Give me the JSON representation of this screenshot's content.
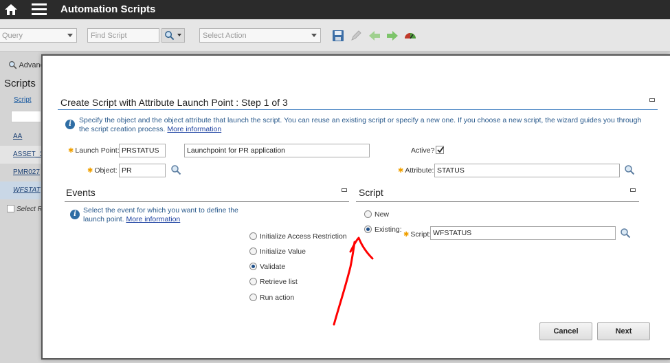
{
  "header": {
    "title": "Automation Scripts"
  },
  "toolbar": {
    "query_placeholder": "Query",
    "find_placeholder": "Find Script",
    "action_placeholder": "Select Action"
  },
  "background": {
    "advanced_label": "Advanc",
    "section_title": "Scripts",
    "column_header": "Script",
    "rows": [
      "AA",
      "ASSET_1",
      "PMR027",
      "WFSTAT"
    ],
    "select_label": "Select R"
  },
  "dialog": {
    "title": "Create Script with Attribute Launch Point : Step 1 of 3",
    "info_text": "Specify the object and the object attribute that launch the script. You can reuse an existing script or specify a new one. If you choose a new script, the wizard guides you through the script creation process.",
    "info_link": "More information",
    "launch_point_label": "Launch Point:",
    "launch_point_value": "PRSTATUS",
    "description_value": "Launchpoint for PR application",
    "active_label": "Active?",
    "object_label": "Object:",
    "object_value": "PR",
    "attribute_label": "Attribute:",
    "attribute_value": "STATUS",
    "events": {
      "title": "Events",
      "info_text": "Select the event for which you want to define the launch point.",
      "info_link": "More information",
      "options": [
        {
          "label": "Initialize Access Restriction",
          "selected": false
        },
        {
          "label": "Initialize Value",
          "selected": false
        },
        {
          "label": "Validate",
          "selected": true
        },
        {
          "label": "Retrieve list",
          "selected": false
        },
        {
          "label": "Run action",
          "selected": false
        }
      ]
    },
    "script": {
      "title": "Script",
      "new_label": "New",
      "existing_label": "Existing:",
      "selected": "Existing",
      "script_label": "Script:",
      "script_value": "WFSTATUS"
    },
    "cancel_label": "Cancel",
    "next_label": "Next"
  },
  "colors": {
    "accent_line": "#3a7bbf",
    "annotation_arrow": "#ff0000"
  }
}
